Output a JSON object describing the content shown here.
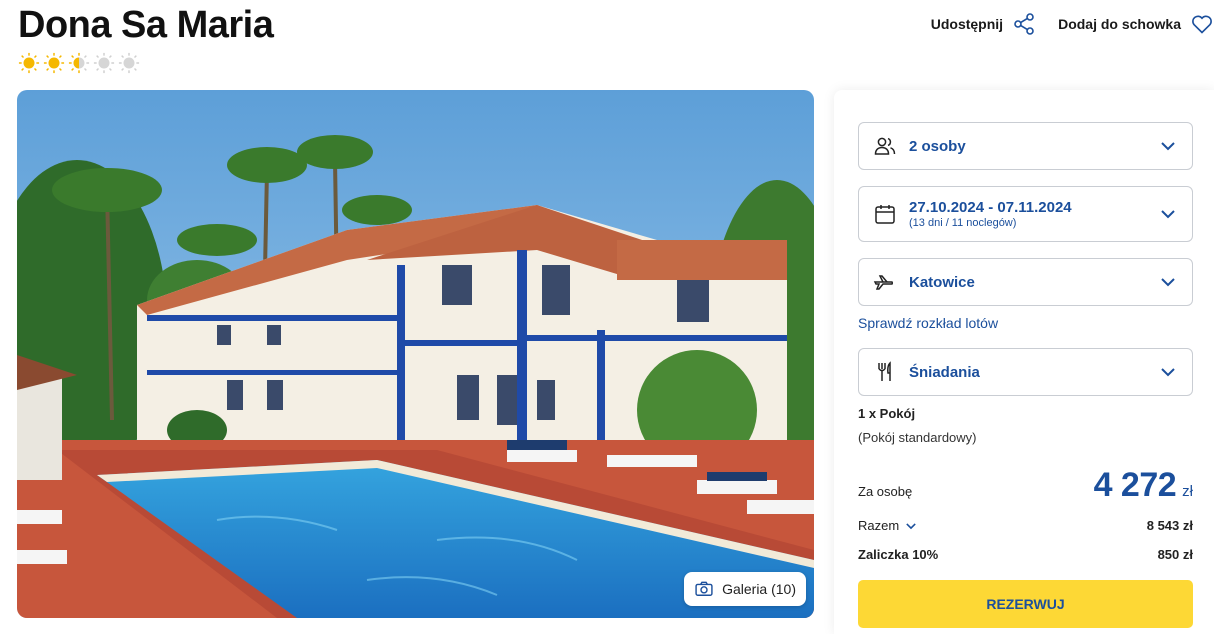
{
  "hotel": {
    "name": "Dona Sa Maria",
    "rating_icons": [
      "sun-full",
      "sun-full",
      "sun-half",
      "sun-empty",
      "sun-empty"
    ],
    "rating_value": 2.5,
    "rating_max": 5
  },
  "header_actions": {
    "share_label": "Udostępnij",
    "save_label": "Dodaj do schowka"
  },
  "gallery": {
    "label": "Galeria (10)"
  },
  "booking": {
    "guests": "2 osoby",
    "dates": "27.10.2024 - 07.11.2024",
    "dates_sub": "(13 dni / 11 noclegów)",
    "departure": "Katowice",
    "flights_link": "Sprawdź rozkład lotów",
    "board": "Śniadania",
    "room_count": "1 x Pokój",
    "room_type": "(Pokój standardowy)",
    "per_person_label": "Za osobę",
    "per_person_price": "4 272",
    "currency": "zł",
    "total_label": "Razem",
    "total_value": "8 543 zł",
    "deposit_label": "Zaliczka 10%",
    "deposit_value": "850 zł",
    "reserve_label": "REZERWUJ"
  },
  "colors": {
    "accent": "#1b4f9c",
    "button": "#fdd835",
    "star": "#f5b800"
  },
  "icons": [
    "share-icon",
    "heart-icon",
    "camera-icon",
    "users-icon",
    "calendar-icon",
    "plane-icon",
    "cutlery-icon",
    "chevron-down-icon"
  ]
}
